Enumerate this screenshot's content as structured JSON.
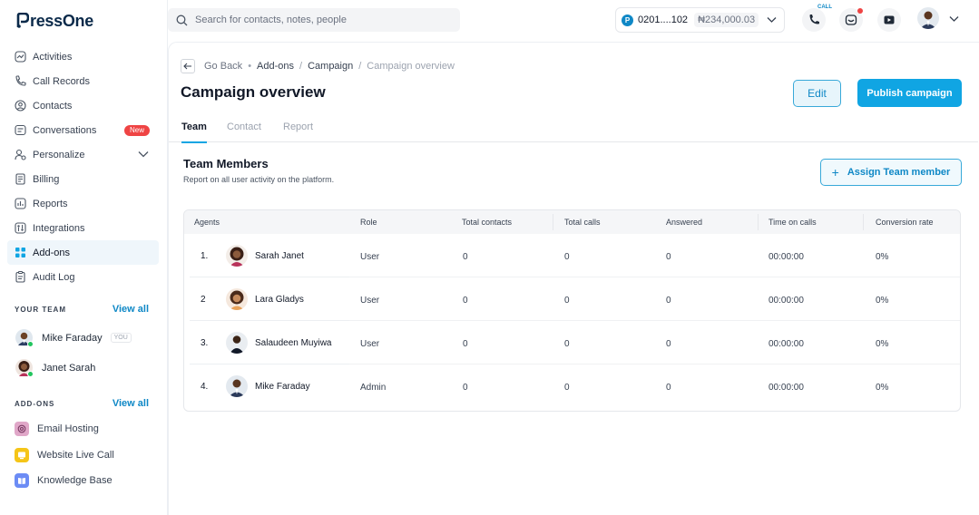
{
  "brand": {
    "logo_text": "ressOne",
    "accent": "#10a5e3"
  },
  "sidebar": {
    "items": [
      {
        "label": "Activities",
        "icon": "activity-icon"
      },
      {
        "label": "Call Records",
        "icon": "phone-icon"
      },
      {
        "label": "Contacts",
        "icon": "contact-icon"
      },
      {
        "label": "Conversations",
        "icon": "chat-icon",
        "badge": "New"
      },
      {
        "label": "Personalize",
        "icon": "personalize-icon"
      },
      {
        "label": "Billing",
        "icon": "billing-icon"
      },
      {
        "label": "Reports",
        "icon": "reports-icon"
      },
      {
        "label": "Integrations",
        "icon": "integrations-icon"
      },
      {
        "label": "Add-ons",
        "icon": "addons-icon",
        "active": true
      },
      {
        "label": "Audit Log",
        "icon": "audit-icon"
      }
    ],
    "your_team": {
      "title": "YOUR TEAM",
      "view_all": "View all",
      "members": [
        {
          "name": "Mike Faraday",
          "tag": "YOU"
        },
        {
          "name": "Janet Sarah"
        }
      ]
    },
    "add_ons": {
      "title": "ADD-ONS",
      "view_all": "View all",
      "items": [
        {
          "label": "Email Hosting",
          "color": "#e0a7c8"
        },
        {
          "label": "Website Live Call",
          "color": "#f5c518"
        },
        {
          "label": "Knowledge Base",
          "color": "#6c8cf5"
        }
      ]
    }
  },
  "topbar": {
    "search_placeholder": "Search for contacts, notes, people",
    "account_number": "0201....102",
    "balance": "₦234,000.03",
    "call_tag": "CALL"
  },
  "breadcrumb": {
    "back": "Go Back",
    "items": [
      "Add-ons",
      "Campaign",
      "Campaign overview"
    ]
  },
  "page": {
    "title": "Campaign overview",
    "edit": "Edit",
    "publish": "Publish campaign"
  },
  "tabs": [
    "Team",
    "Contact",
    "Report"
  ],
  "section": {
    "title": "Team Members",
    "subtitle": "Report on all user activity on the platform.",
    "assign": "Assign Team member"
  },
  "table": {
    "columns": [
      "Agents",
      "Role",
      "Total contacts",
      "Total calls",
      "Answered",
      "Time on calls",
      "Conversion rate"
    ],
    "rows": [
      {
        "index": "1.",
        "name": "Sarah Janet",
        "role": "User",
        "contacts": "0",
        "calls": "0",
        "answered": "0",
        "time": "00:00:00",
        "rate": "0%"
      },
      {
        "index": "2",
        "name": "Lara Gladys",
        "role": "User",
        "contacts": "0",
        "calls": "0",
        "answered": "0",
        "time": "00:00:00",
        "rate": "0%"
      },
      {
        "index": "3.",
        "name": "Salaudeen Muyiwa",
        "role": "User",
        "contacts": "0",
        "calls": "0",
        "answered": "0",
        "time": "00:00:00",
        "rate": "0%"
      },
      {
        "index": "4.",
        "name": "Mike Faraday",
        "role": "Admin",
        "contacts": "0",
        "calls": "0",
        "answered": "0",
        "time": "00:00:00",
        "rate": "0%"
      }
    ]
  }
}
